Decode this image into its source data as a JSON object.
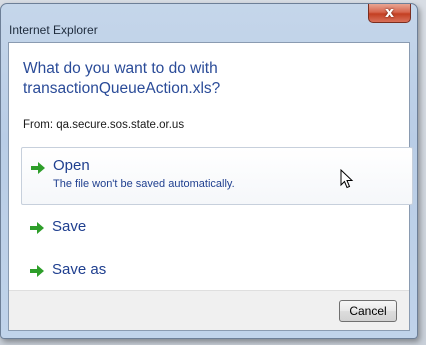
{
  "window": {
    "title": "Internet Explorer",
    "close_label": "x"
  },
  "prompt": {
    "line1": "What do you want to do with",
    "line2": "transactionQueueAction.xls?"
  },
  "source": {
    "from_text": "From: qa.secure.sos.state.or.us"
  },
  "options": [
    {
      "label": "Open",
      "description": "The file won't be saved automatically.",
      "icon": "green-arrow-icon"
    },
    {
      "label": "Save",
      "icon": "green-arrow-icon"
    },
    {
      "label": "Save as",
      "icon": "green-arrow-icon"
    }
  ],
  "footer": {
    "cancel_label": "Cancel"
  },
  "colors": {
    "heading": "#2a4b98",
    "link": "#1f3f8f",
    "arrow": "#2e9e2a",
    "close_button": "#c33f22"
  }
}
